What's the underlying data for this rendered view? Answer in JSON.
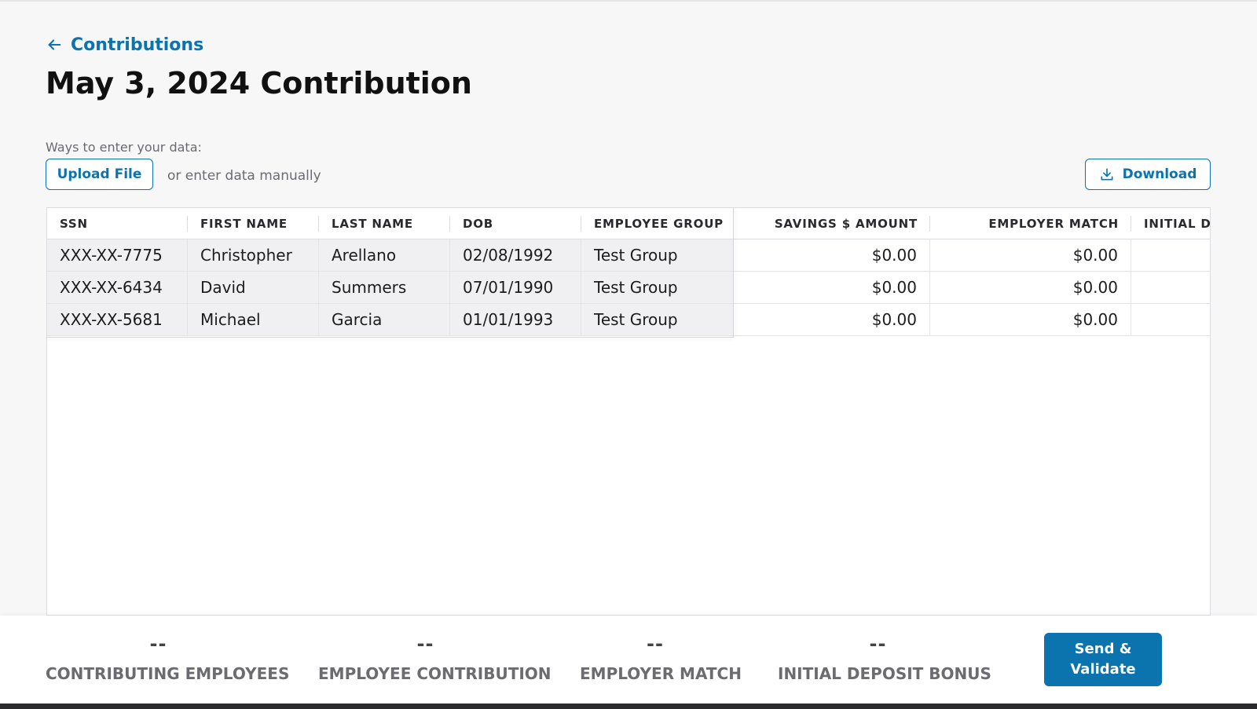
{
  "header": {
    "back_link_label": "Contributions",
    "page_title": "May 3, 2024 Contribution"
  },
  "data_entry": {
    "ways_label": "Ways to enter your data:",
    "upload_button": "Upload File",
    "manual_text": "or enter data manually",
    "download_button": "Download"
  },
  "table": {
    "columns": [
      "SSN",
      "FIRST NAME",
      "LAST NAME",
      "DOB",
      "EMPLOYEE GROUP",
      "SAVINGS $ AMOUNT",
      "EMPLOYER MATCH",
      "INITIAL D"
    ],
    "rows": [
      [
        "XXX-XX-7775",
        "Christopher",
        "Arellano",
        "02/08/1992",
        "Test Group",
        "$0.00",
        "$0.00",
        ""
      ],
      [
        "XXX-XX-6434",
        "David",
        "Summers",
        "07/01/1990",
        "Test Group",
        "$0.00",
        "$0.00",
        ""
      ],
      [
        "XXX-XX-5681",
        "Michael",
        "Garcia",
        "01/01/1993",
        "Test Group",
        "$0.00",
        "$0.00",
        ""
      ]
    ]
  },
  "summary": {
    "contributing_employees": {
      "value": "--",
      "label": "CONTRIBUTING EMPLOYEES"
    },
    "employee_contribution": {
      "value": "--",
      "label": "EMPLOYEE CONTRIBUTION"
    },
    "employer_match": {
      "value": "--",
      "label": "EMPLOYER MATCH"
    },
    "initial_deposit_bonus": {
      "value": "--",
      "label": "INITIAL DEPOSIT BONUS"
    }
  },
  "send_button": {
    "line1": "Send &",
    "line2": "Validate"
  },
  "colors": {
    "accent": "#0b73ad",
    "frozen_bg": "#f0f0f2",
    "page_bg": "#f7f7f8"
  }
}
